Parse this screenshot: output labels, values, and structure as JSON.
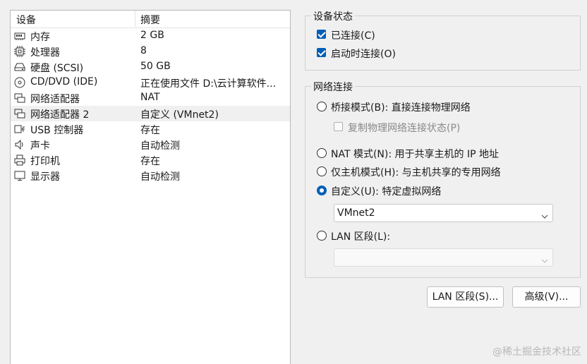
{
  "device_list": {
    "header": {
      "device": "设备",
      "summary": "摘要"
    },
    "rows": [
      {
        "icon": "memory-icon",
        "name": "内存",
        "summary": "2 GB"
      },
      {
        "icon": "processor-icon",
        "name": "处理器",
        "summary": "8"
      },
      {
        "icon": "hard-disk-icon",
        "name": "硬盘 (SCSI)",
        "summary": "50 GB"
      },
      {
        "icon": "cd-dvd-icon",
        "name": "CD/DVD (IDE)",
        "summary": "正在使用文件 D:\\云计算软件..."
      },
      {
        "icon": "network-adapter-icon",
        "name": "网络适配器",
        "summary": "NAT"
      },
      {
        "icon": "network-adapter-icon",
        "name": "网络适配器 2",
        "summary": "自定义 (VMnet2)",
        "selected": true
      },
      {
        "icon": "usb-icon",
        "name": "USB 控制器",
        "summary": "存在"
      },
      {
        "icon": "speaker-icon",
        "name": "声卡",
        "summary": "自动检测"
      },
      {
        "icon": "printer-icon",
        "name": "打印机",
        "summary": "存在"
      },
      {
        "icon": "monitor-icon",
        "name": "显示器",
        "summary": "自动检测"
      }
    ]
  },
  "device_status": {
    "title": "设备状态",
    "connected": {
      "label": "已连接(C)",
      "checked": true
    },
    "connect_at_power_on": {
      "label": "启动时连接(O)",
      "checked": true
    }
  },
  "network_connection": {
    "title": "网络连接",
    "bridged": {
      "label": "桥接模式(B): 直接连接物理网络",
      "selected": false
    },
    "replicate_state": {
      "label": "复制物理网络连接状态(P)",
      "checked": false,
      "disabled": true
    },
    "nat": {
      "label": "NAT 模式(N): 用于共享主机的 IP 地址",
      "selected": false
    },
    "host_only": {
      "label": "仅主机模式(H): 与主机共享的专用网络",
      "selected": false
    },
    "custom": {
      "label": "自定义(U): 特定虚拟网络",
      "selected": true
    },
    "custom_network_select": {
      "value": "VMnet2"
    },
    "lan_segment": {
      "label": "LAN 区段(L):",
      "selected": false
    },
    "lan_segment_select": {
      "value": "",
      "disabled": true
    }
  },
  "buttons": {
    "lan_segments": "LAN 区段(S)...",
    "advanced": "高级(V)..."
  },
  "watermark": "@稀土掘金技术社区",
  "colors": {
    "accent": "#005fb8",
    "selected_row": "#f0f0f0",
    "background": "#f0f0f0"
  }
}
